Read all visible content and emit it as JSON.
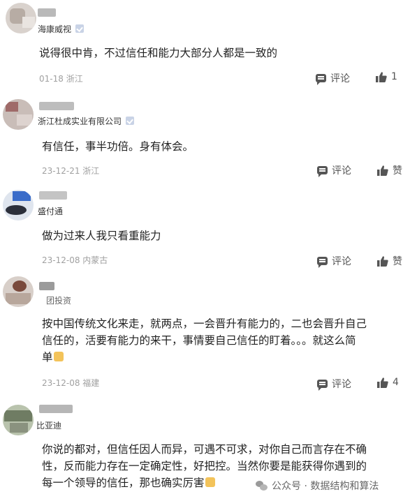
{
  "comments": [
    {
      "username": "海康威视",
      "text": "说得很中肯，不过信任和能力大部分人都是一致的",
      "date": "01-18",
      "location": "浙江",
      "reply_label": "评论",
      "like_label": "1"
    },
    {
      "username": "浙江杜成实业有限公司",
      "text": "有信任，事半功倍。身有体会。",
      "date": "23-12-21",
      "location": "浙江",
      "reply_label": "评论",
      "like_label": "赞"
    },
    {
      "username": "盛付通",
      "text": "做为过来人我只看重能力",
      "date": "23-12-08",
      "location": "内蒙古",
      "reply_label": "评论",
      "like_label": "赞"
    },
    {
      "username": "团投资",
      "text_line1": "按中国传统文化来走，就两点，一会晋升有能力的，二也会晋升自己",
      "text_line2": "信任的，活要有能力的来干，事情要自己信任的盯着。。。就这么简",
      "text_line3": "单",
      "date": "23-12-08",
      "location": "福建",
      "reply_label": "评论",
      "like_label": "4"
    },
    {
      "username": "比亚迪",
      "text_line1": "你说的都对，但信任因人而异，可遇不可求，对你自己而言存在不确",
      "text_line2": "性，反而能力存在一定确定性，好把控。当然你要是能获得你遇到的",
      "text_line3": "每一个领导的信任，那也确实厉害"
    }
  ],
  "watermark": "公众号 · 数据结构和算法",
  "colors": {
    "meta_gray": "#a0a0a0",
    "icon_gray": "#555555",
    "verified_badge": "#c9d3e6",
    "emoji": "#f3c35a"
  }
}
